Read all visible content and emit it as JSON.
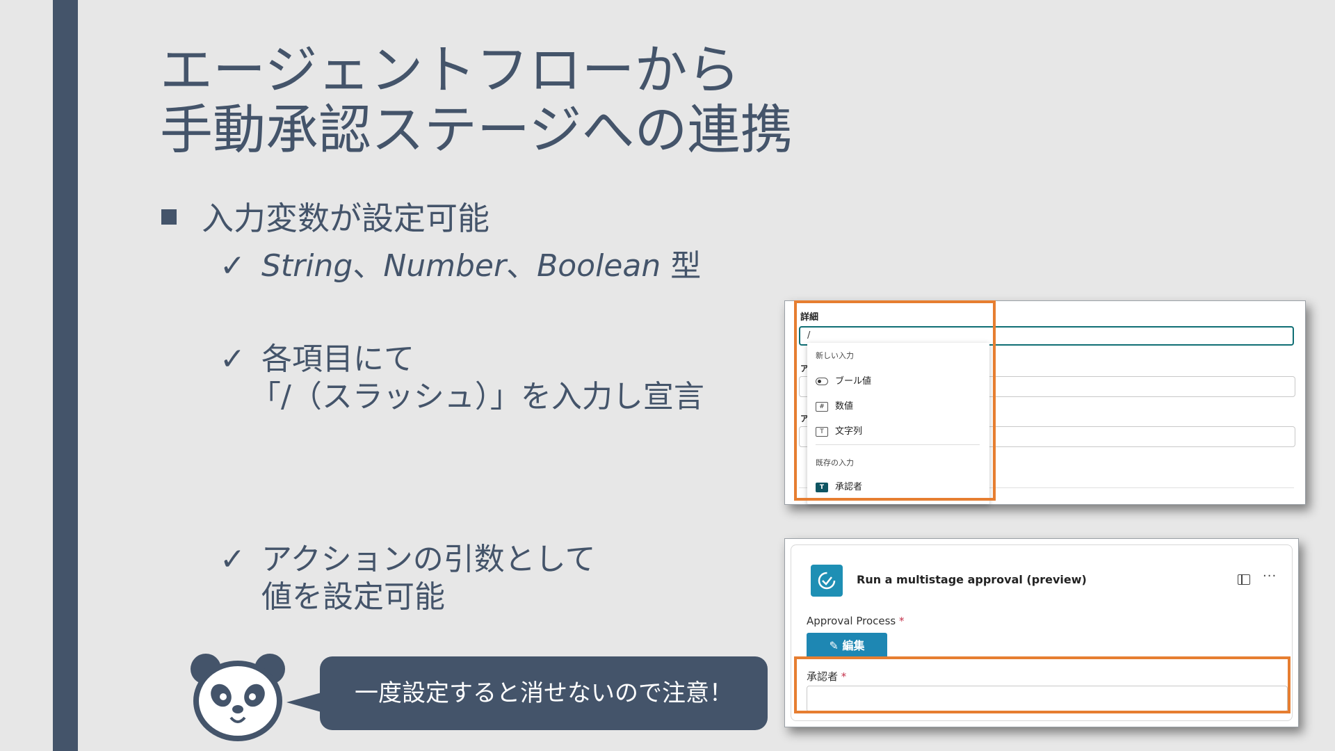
{
  "title": {
    "line1": "エージェントフローから",
    "line2": "手動承認ステージへの連携"
  },
  "bullet": {
    "text": "入力変数が設定可能"
  },
  "checks": {
    "mark": "✓",
    "types": {
      "string": "String",
      "sep1": "、",
      "number": "Number",
      "sep2": "、",
      "boolean": "Boolean",
      "suffix": " 型"
    },
    "slash": {
      "line1": "各項目にて",
      "line2": "「/（スラッシュ）」を入力し宣言"
    },
    "action": {
      "line1": "アクションの引数として",
      "line2": "値を設定可能"
    }
  },
  "screenshot1": {
    "label": "詳細",
    "input_value": "/",
    "field_letter": "ア",
    "dropdown": {
      "new_header": "新しい入力",
      "items": [
        {
          "icon": "toggle-icon",
          "label": "ブール値"
        },
        {
          "icon": "hash-icon",
          "glyph": "#",
          "label": "数値"
        },
        {
          "icon": "text-icon",
          "glyph": "T",
          "label": "文字列"
        }
      ],
      "existing_header": "既存の入力",
      "existing": {
        "icon": "text-solid-icon",
        "glyph": "T",
        "label": "承認者"
      }
    }
  },
  "screenshot2": {
    "action_title": "Run a multistage approval (preview)",
    "more": "···",
    "process_label": "Approval Process",
    "required": "*",
    "edit_label": "✎ 編集",
    "approver_label": "承認者"
  },
  "bubble": {
    "text": "一度設定すると消せないので注意！"
  },
  "colors": {
    "navy": "#44546a",
    "highlight": "#e67e31",
    "teal": "#1e87b3"
  }
}
